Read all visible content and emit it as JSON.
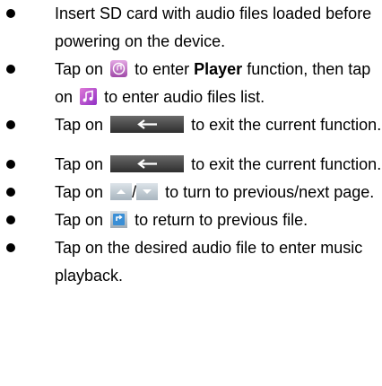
{
  "section1": {
    "items": [
      {
        "text": "Insert SD card with audio files loaded before powering on the device."
      },
      {
        "pre": "Tap on",
        "mid": "to enter",
        "bold": "Player",
        "post": "function, then tap on",
        "end": "to enter audio files list."
      },
      {
        "pre": "Tap on",
        "post": "to exit the current function."
      }
    ]
  },
  "section2": {
    "items": [
      {
        "pre": "Tap on",
        "post": "to exit the current function."
      },
      {
        "pre": "Tap on",
        "slash": "/",
        "post": "to turn to previous/next page."
      },
      {
        "pre": "Tap on",
        "post": "to return to previous file."
      },
      {
        "text": "Tap on the desired audio file to enter music playback."
      }
    ]
  },
  "icons": {
    "player": "music-disc-icon",
    "audio_list": "music-note-icon",
    "back": "back-arrow-icon",
    "prev": "page-up-icon",
    "next": "page-down-icon",
    "return": "return-icon"
  },
  "colors": {
    "player_icon": "#c86ec8",
    "audio_icon": "#c15ad6",
    "back_bar": "#4d4d4d",
    "page_btn": "#b8c4cc",
    "return_btn": "#3a8fd6"
  }
}
